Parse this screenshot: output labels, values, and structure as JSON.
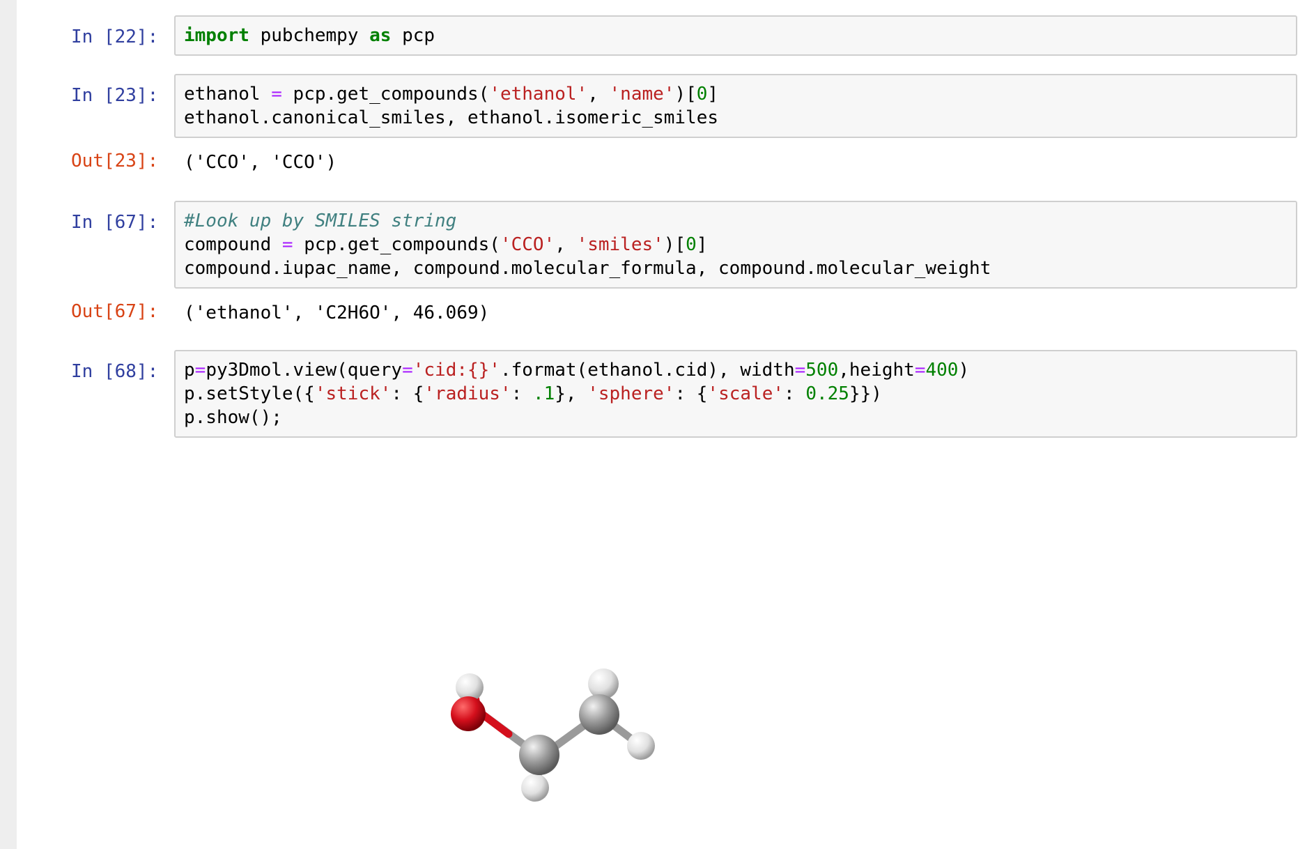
{
  "cells": [
    {
      "prompt": "In [22]:",
      "lines": [
        [
          [
            "kw",
            "import"
          ],
          [
            "txt",
            " pubchempy "
          ],
          [
            "kw",
            "as"
          ],
          [
            "txt",
            " pcp"
          ]
        ]
      ]
    },
    {
      "prompt": "In [23]:",
      "lines": [
        [
          [
            "txt",
            "ethanol "
          ],
          [
            "op",
            "="
          ],
          [
            "txt",
            " pcp.get_compounds("
          ],
          [
            "str",
            "'ethanol'"
          ],
          [
            "txt",
            ", "
          ],
          [
            "str",
            "'name'"
          ],
          [
            "txt",
            ")["
          ],
          [
            "num",
            "0"
          ],
          [
            "txt",
            "]"
          ]
        ],
        [
          [
            "txt",
            "ethanol.canonical_smiles, ethanol.isomeric_smiles"
          ]
        ]
      ],
      "out_prompt": "Out[23]:",
      "output": "('CCO', 'CCO')"
    },
    {
      "prompt": "In [67]:",
      "lines": [
        [
          [
            "com",
            "#Look up by SMILES string"
          ]
        ],
        [
          [
            "txt",
            "compound "
          ],
          [
            "op",
            "="
          ],
          [
            "txt",
            " pcp.get_compounds("
          ],
          [
            "str",
            "'CCO'"
          ],
          [
            "txt",
            ", "
          ],
          [
            "str",
            "'smiles'"
          ],
          [
            "txt",
            ")["
          ],
          [
            "num",
            "0"
          ],
          [
            "txt",
            "]"
          ]
        ],
        [
          [
            "txt",
            "compound.iupac_name, compound.molecular_formula, compound.molecular_weight"
          ]
        ]
      ],
      "out_prompt": "Out[67]:",
      "output": "('ethanol', 'C2H6O', 46.069)"
    },
    {
      "prompt": "In [68]:",
      "lines": [
        [
          [
            "txt",
            "p"
          ],
          [
            "op",
            "="
          ],
          [
            "txt",
            "py3Dmol.view(query"
          ],
          [
            "op",
            "="
          ],
          [
            "str",
            "'cid:{}'"
          ],
          [
            "txt",
            ".format(ethanol.cid), width"
          ],
          [
            "op",
            "="
          ],
          [
            "num",
            "500"
          ],
          [
            "txt",
            ",height"
          ],
          [
            "op",
            "="
          ],
          [
            "num",
            "400"
          ],
          [
            "txt",
            ")"
          ]
        ],
        [
          [
            "txt",
            "p.setStyle({"
          ],
          [
            "str",
            "'stick'"
          ],
          [
            "txt",
            ": {"
          ],
          [
            "str",
            "'radius'"
          ],
          [
            "txt",
            ": "
          ],
          [
            "num",
            ".1"
          ],
          [
            "txt",
            "}, "
          ],
          [
            "str",
            "'sphere'"
          ],
          [
            "txt",
            ": {"
          ],
          [
            "str",
            "'scale'"
          ],
          [
            "txt",
            ": "
          ],
          [
            "num",
            "0.25"
          ],
          [
            "txt",
            "}})"
          ]
        ],
        [
          [
            "txt",
            "p.show();"
          ]
        ]
      ]
    }
  ],
  "molecule": {
    "name": "ethanol",
    "atom_colors": {
      "O": "#d40f1c",
      "C": "#9a9a9a",
      "H": "#e6e6e6"
    }
  },
  "colors": {
    "in_prompt": "#303f9f",
    "out_prompt": "#d84315",
    "keyword": "#008000",
    "string": "#ba2121",
    "number": "#008000",
    "operator": "#aa22ff",
    "comment": "#408080"
  }
}
